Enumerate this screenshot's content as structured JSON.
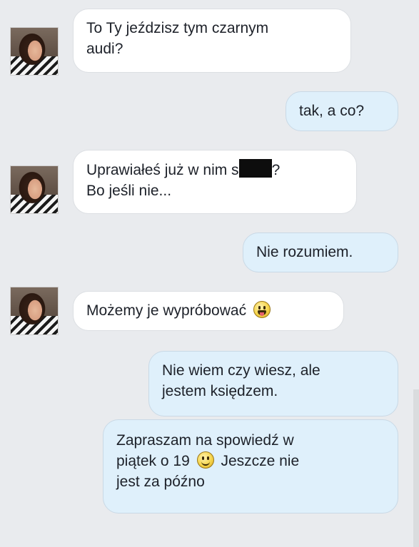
{
  "messages": [
    {
      "from": "them",
      "text": "To Ty jeździsz tym czarnym\naudi?"
    },
    {
      "from": "me",
      "text": "tak, a co?"
    },
    {
      "from": "them",
      "text_before": "Uprawiałeś już w nim s",
      "text_after": "?",
      "line2": "Bo jeśli nie..."
    },
    {
      "from": "me",
      "text": "Nie rozumiem."
    },
    {
      "from": "them",
      "text": "Możemy je wypróbować",
      "emoji": "tongue-out-emoji"
    },
    {
      "from": "me",
      "text": "Nie wiem czy wiesz, ale\njestem księdzem."
    },
    {
      "from": "me",
      "line1": "Zapraszam na spowiedź w",
      "line2_before": "piątek o 19",
      "line2_after": "Jeszcze nie",
      "line3": "jest za późno",
      "emoji": "smile-emoji"
    }
  ]
}
